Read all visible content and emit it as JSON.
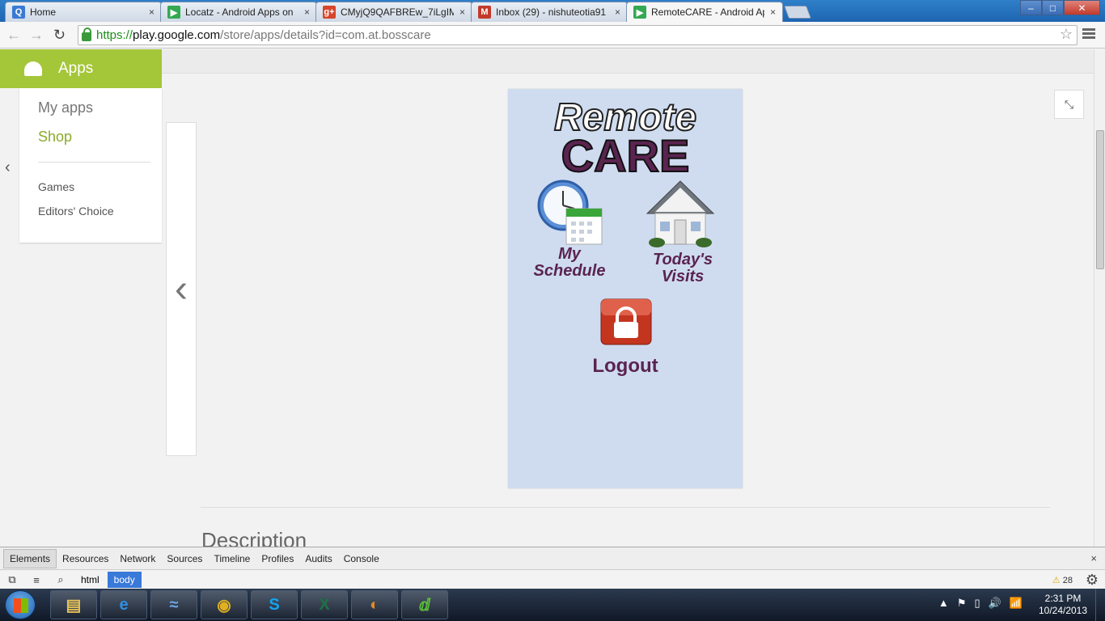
{
  "browser": {
    "tabs": [
      {
        "title": "Home",
        "icon": "quora-q-icon",
        "color": "#3a7ad4",
        "glyph": "Q"
      },
      {
        "title": "Locatz - Android Apps on",
        "icon": "google-play-icon",
        "color": "#34a853",
        "glyph": "▶"
      },
      {
        "title": "CMyjQ9QAFBREw_7iLgIM",
        "icon": "google-plus-icon",
        "color": "#d7452c",
        "glyph": "g+"
      },
      {
        "title": "Inbox (29) - nishuteotia91",
        "icon": "gmail-icon",
        "color": "#c23a2a",
        "glyph": "M"
      },
      {
        "title": "RemoteCARE - Android Ap",
        "icon": "google-play-icon",
        "color": "#34a853",
        "glyph": "▶",
        "active": true
      }
    ],
    "tab_close_glyph": "×",
    "window_buttons": {
      "minimize": "–",
      "maximize": "□",
      "close": "✕"
    },
    "url": {
      "scheme": "https://",
      "host": "play.google.com",
      "path": "/store/apps/details?id=com.at.bosscare"
    },
    "nav": {
      "back": "←",
      "forward": "→",
      "reload": "↻"
    },
    "star_glyph": "☆"
  },
  "sidebar": {
    "header": "Apps",
    "primary": [
      {
        "label": "My apps"
      },
      {
        "label": "Shop",
        "active": true
      }
    ],
    "secondary": [
      {
        "label": "Games"
      },
      {
        "label": "Editors' Choice"
      }
    ],
    "collapse_glyph": "‹"
  },
  "gallery": {
    "prev_glyph": "‹",
    "collapse_glyph": "⤡",
    "screenshot": {
      "brand_top": "Remote",
      "brand_bottom": "CARE",
      "tiles": [
        {
          "label_line1": "My",
          "label_line2": "Schedule"
        },
        {
          "label_line1": "Today's",
          "label_line2": "Visits"
        },
        {
          "label_line1": "Logout",
          "label_line2": ""
        }
      ]
    }
  },
  "section_heading": "Description",
  "devtools": {
    "tabs": [
      "Elements",
      "Resources",
      "Network",
      "Sources",
      "Timeline",
      "Profiles",
      "Audits",
      "Console"
    ],
    "close_glyph": "×",
    "breadcrumbs": [
      {
        "label": "html"
      },
      {
        "label": "body",
        "selected": true
      }
    ],
    "warnings": "28",
    "warning_glyph": "⚠",
    "gear_glyph": "⚙"
  },
  "taskbar": {
    "apps": [
      {
        "name": "explorer-icon",
        "glyph": "▤",
        "color": "#e8c35a"
      },
      {
        "name": "internet-explorer-icon",
        "glyph": "e",
        "color": "#2f8fe0"
      },
      {
        "name": "dolphin-icon",
        "glyph": "≈",
        "color": "#6fa8e8"
      },
      {
        "name": "chrome-icon",
        "glyph": "◉",
        "color": "#e0b020"
      },
      {
        "name": "skype-icon",
        "glyph": "S",
        "color": "#12a5f4"
      },
      {
        "name": "excel-icon",
        "glyph": "X",
        "color": "#1e7145"
      },
      {
        "name": "media-player-icon",
        "glyph": "◐",
        "color": "#e08a2a"
      },
      {
        "name": "dreamweaver-icon",
        "glyph": "ⅆ",
        "color": "#5bbf3a"
      }
    ],
    "tray_icons": [
      "▲",
      "⚑",
      "▯",
      "🔊",
      "📶"
    ],
    "time": "2:31 PM",
    "date": "10/24/2013"
  }
}
